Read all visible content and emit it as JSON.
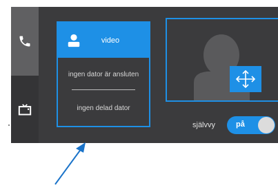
{
  "nav": {
    "phone_icon": "phone-icon",
    "tv_icon": "tv-icon"
  },
  "card": {
    "title": "video",
    "status_computer": "ingen dator är ansluten",
    "status_shared": "ingen delad dator",
    "user_icon": "user-icon"
  },
  "preview": {
    "avatar_icon": "person-icon",
    "move_icon": "move-arrows-icon"
  },
  "selfview": {
    "label": "självvy",
    "toggle_label": "på",
    "state": "on"
  },
  "colors": {
    "accent": "#1e90e6",
    "panel": "#3b3b3d",
    "sidebar_active": "#606062",
    "arrow": "#1a73c9"
  }
}
